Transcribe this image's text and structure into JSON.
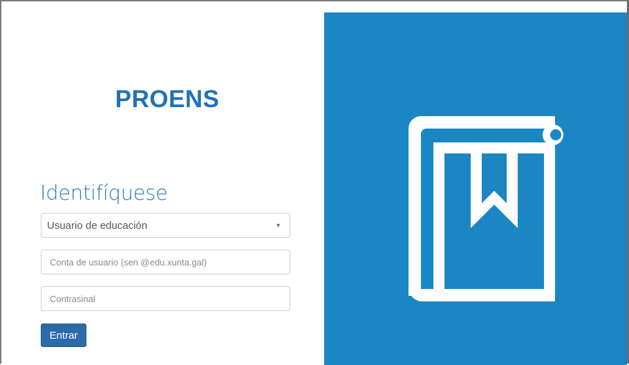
{
  "app": {
    "title": "PROENS"
  },
  "login": {
    "heading": "Identifíquese",
    "user_type": {
      "selected": "Usuario de educación",
      "arrow": "▼"
    },
    "username": {
      "value": "",
      "placeholder": "Conta de usuario (sen @edu.xunta.gal)"
    },
    "password": {
      "value": "",
      "placeholder": "Contrasinal"
    },
    "submit_label": "Entrar"
  },
  "branding": {
    "icon": "book-bookmark-icon",
    "background_color": "#1a86c3",
    "title_color": "#2271b5"
  }
}
